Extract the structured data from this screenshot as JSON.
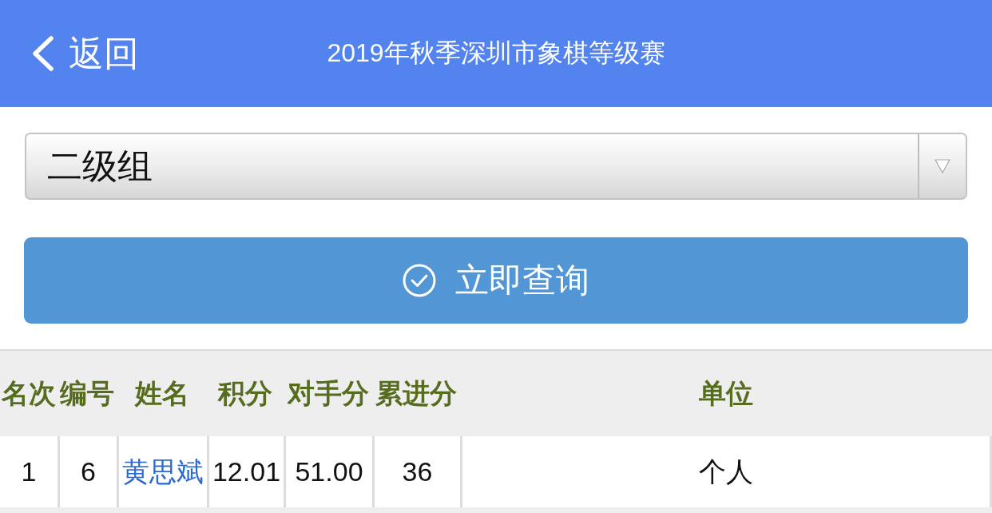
{
  "header": {
    "back_label": "返回",
    "title": "2019年秋季深圳市象棋等级赛"
  },
  "group_select": {
    "value": "二级组"
  },
  "query_button": {
    "label": "立即查询"
  },
  "table": {
    "columns": [
      "名次",
      "编号",
      "姓名",
      "积分",
      "对手分",
      "累进分",
      "单位"
    ],
    "rows": [
      {
        "cells": [
          {
            "kind": "text",
            "text": "1"
          },
          {
            "kind": "text",
            "text": "6"
          },
          {
            "kind": "link",
            "text": "黄思斌"
          },
          {
            "kind": "text",
            "text": "12.01"
          },
          {
            "kind": "text",
            "text": "51.00"
          },
          {
            "kind": "text",
            "text": "36"
          },
          {
            "kind": "text",
            "text": "个人"
          }
        ]
      }
    ]
  }
}
